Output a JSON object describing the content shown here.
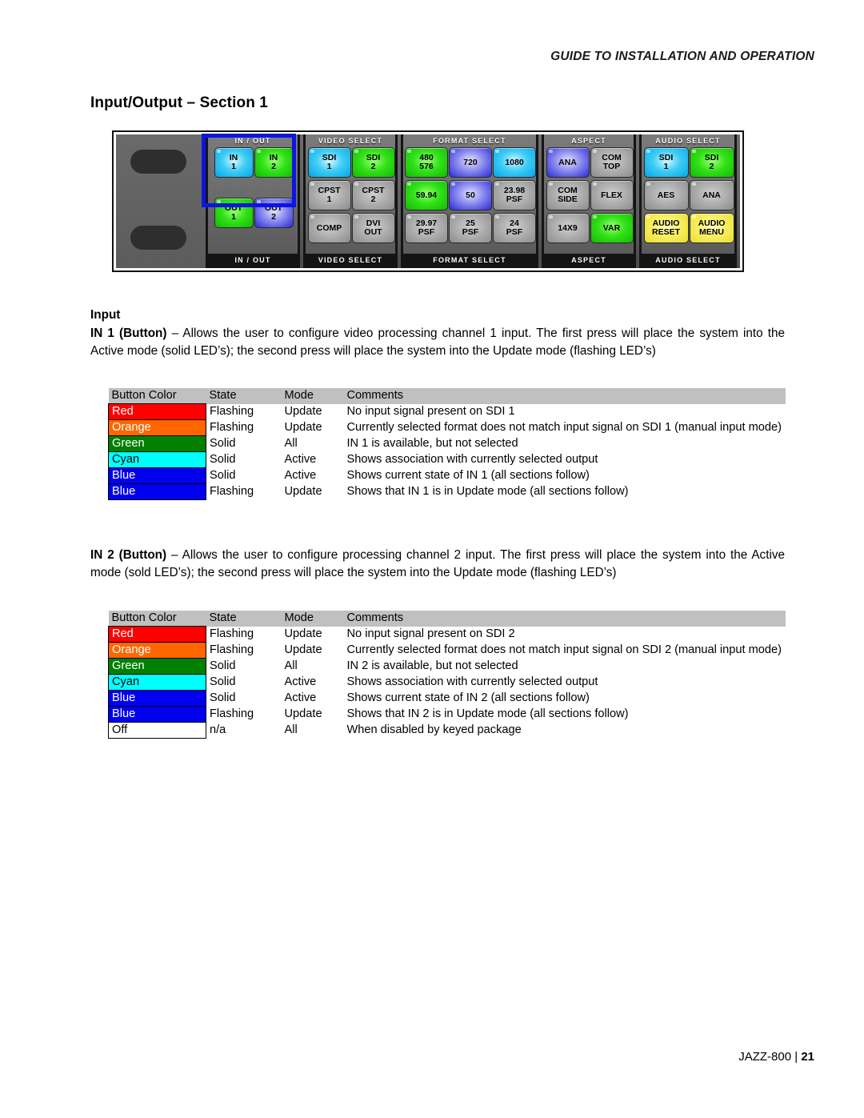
{
  "header": {
    "running_head": "GUIDE TO INSTALLATION AND OPERATION"
  },
  "page_title": "Input/Output – Section 1",
  "panel": {
    "sections": [
      {
        "name": "in-out",
        "top_label": "IN / OUT",
        "bottom_label": "IN / OUT",
        "buttons": [
          {
            "lines": [
              "IN",
              "1"
            ],
            "color": "cyan"
          },
          {
            "lines": [
              "IN",
              "2"
            ],
            "color": "green"
          },
          {
            "lines": [
              "OUT",
              "1"
            ],
            "color": "green"
          },
          {
            "lines": [
              "OUT",
              "2"
            ],
            "color": "blue"
          }
        ]
      },
      {
        "name": "video-select",
        "top_label": "VIDEO SELECT",
        "bottom_label": "VIDEO SELECT",
        "buttons": [
          {
            "lines": [
              "SDI",
              "1"
            ],
            "color": "cyan"
          },
          {
            "lines": [
              "SDI",
              "2"
            ],
            "color": "green"
          },
          {
            "lines": [
              "CPST",
              "1"
            ],
            "color": "grey"
          },
          {
            "lines": [
              "CPST",
              "2"
            ],
            "color": "grey"
          },
          {
            "lines": [
              "COMP"
            ],
            "color": "grey"
          },
          {
            "lines": [
              "DVI",
              "OUT"
            ],
            "color": "grey"
          }
        ]
      },
      {
        "name": "format-select",
        "top_label": "FORMAT SELECT",
        "bottom_label": "FORMAT SELECT",
        "buttons": [
          {
            "lines": [
              "480",
              "576"
            ],
            "color": "green"
          },
          {
            "lines": [
              "720"
            ],
            "color": "blue"
          },
          {
            "lines": [
              "1080"
            ],
            "color": "cyan"
          },
          {
            "lines": [
              "59.94"
            ],
            "color": "green"
          },
          {
            "lines": [
              "50"
            ],
            "color": "blue"
          },
          {
            "lines": [
              "23.98",
              "PSF"
            ],
            "color": "grey"
          },
          {
            "lines": [
              "29.97",
              "PSF"
            ],
            "color": "grey"
          },
          {
            "lines": [
              "25",
              "PSF"
            ],
            "color": "grey"
          },
          {
            "lines": [
              "24",
              "PSF"
            ],
            "color": "grey"
          }
        ]
      },
      {
        "name": "aspect",
        "top_label": "ASPECT",
        "bottom_label": "ASPECT",
        "buttons": [
          {
            "lines": [
              "ANA"
            ],
            "color": "blue"
          },
          {
            "lines": [
              "COM",
              "TOP"
            ],
            "color": "grey"
          },
          {
            "lines": [
              "COM",
              "SIDE"
            ],
            "color": "grey"
          },
          {
            "lines": [
              "FLEX"
            ],
            "color": "grey"
          },
          {
            "lines": [
              "14X9"
            ],
            "color": "grey"
          },
          {
            "lines": [
              "VAR"
            ],
            "color": "green"
          }
        ]
      },
      {
        "name": "audio-select",
        "top_label": "AUDIO SELECT",
        "bottom_label": "AUDIO SELECT",
        "buttons": [
          {
            "lines": [
              "SDI",
              "1"
            ],
            "color": "cyan"
          },
          {
            "lines": [
              "SDI",
              "2"
            ],
            "color": "green"
          },
          {
            "lines": [
              "AES"
            ],
            "color": "grey"
          },
          {
            "lines": [
              "ANA"
            ],
            "color": "grey"
          },
          {
            "lines": [
              "AUDIO",
              "RESET"
            ],
            "color": "yellow"
          },
          {
            "lines": [
              "AUDIO",
              "MENU"
            ],
            "color": "yellow"
          }
        ]
      }
    ],
    "highlight_color": "#0a16e0"
  },
  "sections": {
    "input_heading": "Input",
    "in1": {
      "lead": "IN 1 (Button)",
      "body": " – Allows the user to configure video processing channel 1 input. The first press will place the system into the Active mode (solid LED’s); the second press will place the system into the Update mode (flashing LED’s)",
      "table": {
        "headers": [
          "Button Color",
          "State",
          "Mode",
          "Comments"
        ],
        "rows": [
          {
            "color_label": "Red",
            "swatch": "red",
            "state": "Flashing",
            "mode": "Update",
            "comment": "No input signal present on SDI 1"
          },
          {
            "color_label": "Orange",
            "swatch": "orange",
            "state": "Flashing",
            "mode": "Update",
            "comment": "Currently selected format does not match input signal on SDI 1 (manual input mode)"
          },
          {
            "color_label": "Green",
            "swatch": "green",
            "state": "Solid",
            "mode": "All",
            "comment": "IN 1 is available, but not selected"
          },
          {
            "color_label": "Cyan",
            "swatch": "cyan",
            "state": "Solid",
            "mode": "Active",
            "comment": "Shows association with currently selected output"
          },
          {
            "color_label": "Blue",
            "swatch": "blue",
            "state": "Solid",
            "mode": "Active",
            "comment": "Shows current state of IN 1 (all sections follow)"
          },
          {
            "color_label": "Blue",
            "swatch": "blue",
            "state": "Flashing",
            "mode": "Update",
            "comment": "Shows that IN 1 is in Update mode (all sections follow)"
          }
        ]
      }
    },
    "in2": {
      "lead": "IN 2 (Button)",
      "body": " – Allows the user to configure processing channel 2 input. The first press will place the system into the Active mode (sold LED’s); the second press will place the system into the Update mode (flashing LED’s)",
      "table": {
        "headers": [
          "Button Color",
          "State",
          "Mode",
          "Comments"
        ],
        "rows": [
          {
            "color_label": "Red",
            "swatch": "red",
            "state": "Flashing",
            "mode": "Update",
            "comment": "No input signal present on SDI 2"
          },
          {
            "color_label": "Orange",
            "swatch": "orange",
            "state": "Flashing",
            "mode": "Update",
            "comment": "Currently selected format does not match input signal on SDI 2 (manual input mode)"
          },
          {
            "color_label": "Green",
            "swatch": "green",
            "state": "Solid",
            "mode": "All",
            "comment": "IN 2 is available, but not selected"
          },
          {
            "color_label": "Cyan",
            "swatch": "cyan",
            "state": "Solid",
            "mode": "Active",
            "comment": "Shows association with currently selected output"
          },
          {
            "color_label": "Blue",
            "swatch": "blue",
            "state": "Solid",
            "mode": "Active",
            "comment": "Shows current state of IN 2 (all sections follow)"
          },
          {
            "color_label": "Blue",
            "swatch": "blue",
            "state": "Flashing",
            "mode": "Update",
            "comment": "Shows that IN 2 is in Update mode (all sections follow)"
          },
          {
            "color_label": "Off",
            "swatch": "off",
            "state": "n/a",
            "mode": "All",
            "comment": "When disabled by keyed package"
          }
        ]
      }
    }
  },
  "footer": {
    "product": "JAZZ-800",
    "separator": "|",
    "page_number": "21"
  },
  "colors": {
    "red": "#ff0000",
    "orange": "#ff6600",
    "green": "#007f00",
    "cyan": "#00ffff",
    "blue": "#0000ee",
    "off": "#ffffff",
    "table_header": "#c0c0c0"
  }
}
